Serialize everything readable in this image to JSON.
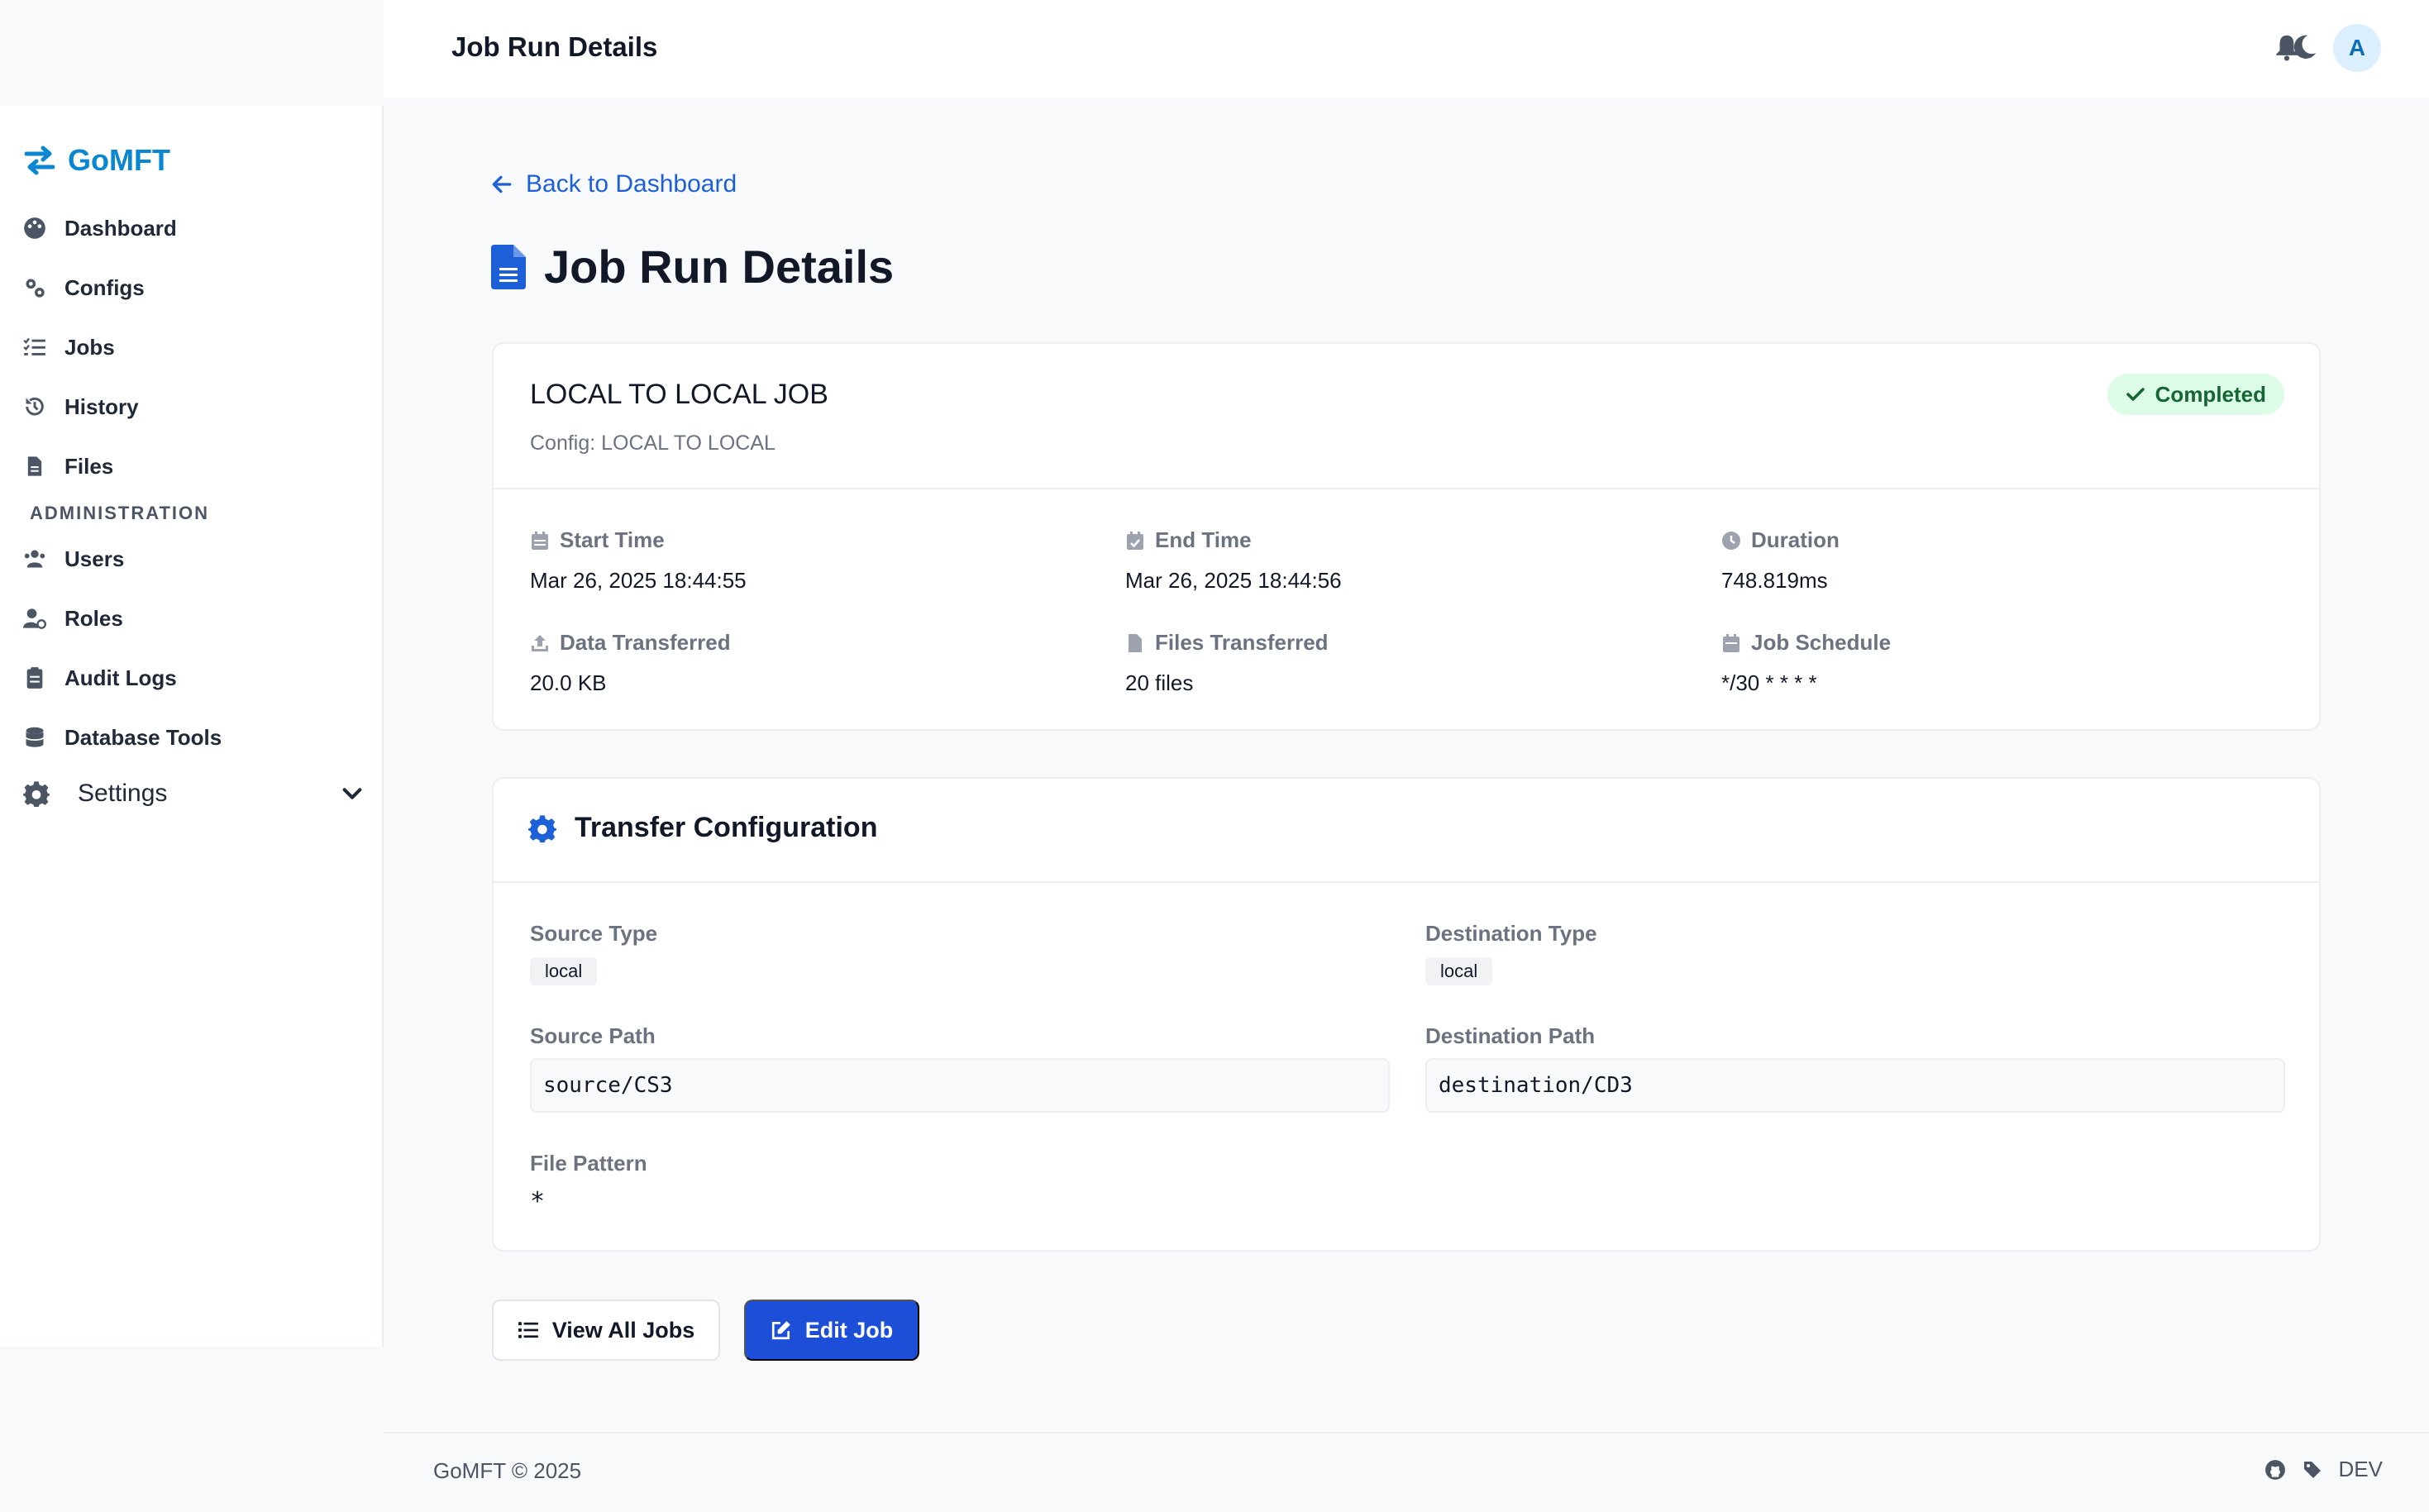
{
  "app": {
    "brand": "GoMFT"
  },
  "sidebar": {
    "items": [
      {
        "label": "Dashboard",
        "icon": "palette-icon"
      },
      {
        "label": "Configs",
        "icon": "cogs-icon"
      },
      {
        "label": "Jobs",
        "icon": "tasks-icon"
      },
      {
        "label": "History",
        "icon": "history-icon"
      },
      {
        "label": "Files",
        "icon": "file-icon"
      }
    ],
    "admin_section": "ADMINISTRATION",
    "admin_items": [
      {
        "label": "Users",
        "icon": "users-icon"
      },
      {
        "label": "Roles",
        "icon": "user-cog-icon"
      },
      {
        "label": "Audit Logs",
        "icon": "clipboard-icon"
      },
      {
        "label": "Database Tools",
        "icon": "database-icon"
      }
    ],
    "settings": {
      "label": "Settings",
      "icon": "gear-icon"
    }
  },
  "header": {
    "title": "Job Run Details",
    "avatar_initial": "A"
  },
  "page": {
    "back_link": "Back to Dashboard",
    "title": "Job Run Details"
  },
  "job": {
    "name": "LOCAL TO LOCAL JOB",
    "config": "Config: LOCAL TO LOCAL",
    "status": "Completed",
    "status_color": "#166534",
    "stats": {
      "start_time_label": "Start Time",
      "start_time": "Mar 26, 2025 18:44:55",
      "end_time_label": "End Time",
      "end_time": "Mar 26, 2025 18:44:56",
      "duration_label": "Duration",
      "duration": "748.819ms",
      "data_label": "Data Transferred",
      "data": "20.0 KB",
      "files_label": "Files Transferred",
      "files": "20 files",
      "schedule_label": "Job Schedule",
      "schedule": "*/30 * * * *"
    }
  },
  "transfer": {
    "title": "Transfer Configuration",
    "source_type_label": "Source Type",
    "source_type": "local",
    "dest_type_label": "Destination Type",
    "dest_type": "local",
    "source_path_label": "Source Path",
    "source_path": "source/CS3",
    "dest_path_label": "Destination Path",
    "dest_path": "destination/CD3",
    "pattern_label": "File Pattern",
    "pattern": "*"
  },
  "actions": {
    "view_all": "View All Jobs",
    "edit": "Edit Job"
  },
  "footer": {
    "copyright": "GoMFT © 2025",
    "env": "DEV"
  },
  "colors": {
    "accent": "#1d4ed8",
    "brand": "#0b86d1",
    "success_bg": "#dcfce7"
  }
}
